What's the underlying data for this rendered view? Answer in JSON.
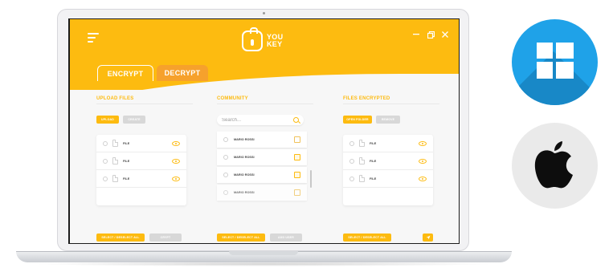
{
  "app": {
    "logo_text": "YOU KEY",
    "tabs": [
      {
        "label": "ENCRYPT",
        "active": true
      },
      {
        "label": "DECRYPT",
        "active": false
      }
    ],
    "upload_files": {
      "title": "UPLOAD FILES",
      "buttons": [
        "UPLOAD",
        "CREATE"
      ],
      "files": [
        "FILE",
        "FILE",
        "FILE"
      ],
      "select_all_label": "SELECT / DESELECT ALL",
      "action_label": "CRYPT"
    },
    "community": {
      "title": "COMMUNITY",
      "search_placeholder": "Search...",
      "members": [
        "MARIO ROSSI",
        "MARIO ROSSI",
        "MARIO ROSSI",
        "MARIO ROSSI"
      ],
      "select_all_label": "SELECT / DESELECT ALL",
      "action_label": "ADD USER"
    },
    "files_encrypted": {
      "title": "FILES ENCRYPTED",
      "buttons": [
        "OPEN FOLDER",
        "REMOVE"
      ],
      "files": [
        "FILE",
        "FILE",
        "FILE"
      ],
      "select_all_label": "SELECT / DESELECT ALL"
    }
  },
  "icons": {
    "menu": "hamburger-icon",
    "minimize": "minimize-icon",
    "restore": "restore-icon",
    "close": "close-icon",
    "search": "search-icon",
    "eye": "eye-icon",
    "file": "file-icon",
    "key": "key-icon",
    "send": "send-icon",
    "windows": "windows-logo",
    "apple": "apple-logo"
  },
  "colors": {
    "brand_yellow": "#fdbb10",
    "tab_orange": "#f6a12c",
    "windows_blue": "#1fa2e8"
  }
}
